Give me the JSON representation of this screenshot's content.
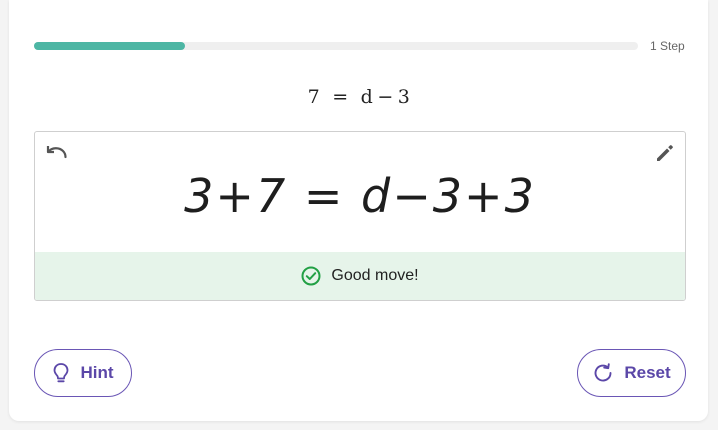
{
  "progress": {
    "fraction": 0.25,
    "label": "1 Step",
    "color": "#4db6a4"
  },
  "problem": {
    "left": "7",
    "equals": "=",
    "right_var": "d",
    "minus": "−",
    "right_num": "3"
  },
  "work": {
    "expression": "3+7 = d−3+3"
  },
  "feedback": {
    "text": "Good move!",
    "color": "#22a045"
  },
  "buttons": {
    "hint_label": "Hint",
    "reset_label": "Reset",
    "accent": "#5b47a8"
  },
  "icons": {
    "undo": "undo-icon",
    "edit": "pencil-icon",
    "check": "check-circle-icon",
    "hint": "lightbulb-icon",
    "reset": "refresh-icon"
  }
}
